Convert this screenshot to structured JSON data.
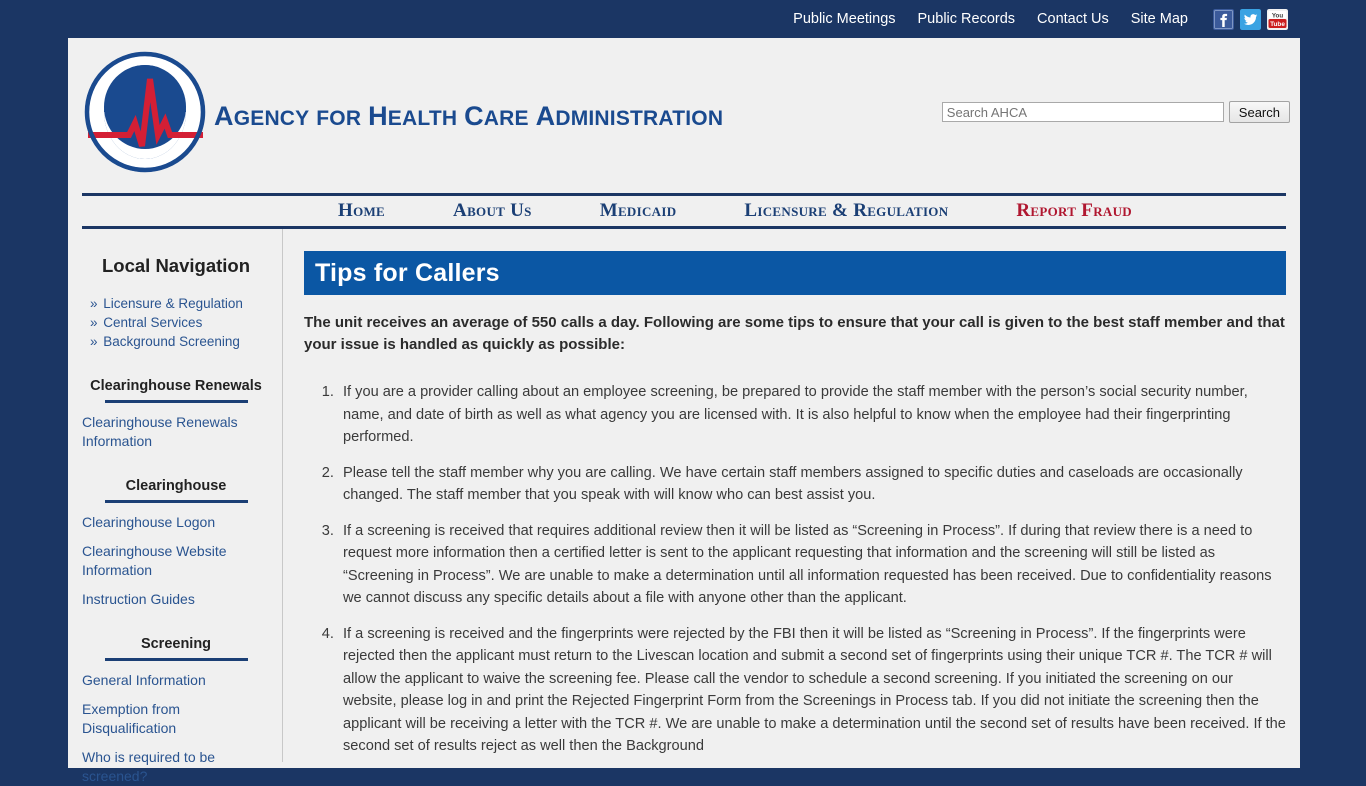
{
  "topbar": {
    "links": [
      {
        "label": "Public Meetings",
        "name": "public-meetings"
      },
      {
        "label": "Public Records",
        "name": "public-records"
      },
      {
        "label": "Contact Us",
        "name": "contact-us"
      },
      {
        "label": "Site Map",
        "name": "site-map"
      }
    ],
    "social": [
      {
        "icon": "facebook-icon",
        "label": "f",
        "color": "#3b5a9a"
      },
      {
        "icon": "twitter-icon",
        "label": "",
        "color": "#3aa3e3"
      },
      {
        "icon": "youtube-icon",
        "label": "You Tube",
        "color": "#cc1f1f"
      }
    ]
  },
  "header": {
    "logo_alt": "ahca-seal-logo",
    "brand": {
      "a1": "A",
      "w1": "GENCY",
      "sp1": " ",
      "f": "FOR",
      "sp2": " ",
      "h": "H",
      "w2": "EALTH",
      "sp3": " ",
      "c": "C",
      "w3": "ARE",
      "sp4": " ",
      "a2": "A",
      "w4": "DMINISTRATION"
    },
    "brand_full": "Agency for Health Care Administration",
    "search": {
      "placeholder": "Search AHCA",
      "value": "",
      "button_label": "Search"
    }
  },
  "mainnav": {
    "items": [
      {
        "label": "Home",
        "name": "nav-home",
        "alert": false
      },
      {
        "label": "About Us",
        "name": "nav-about-us",
        "alert": false
      },
      {
        "label": "Medicaid",
        "name": "nav-medicaid",
        "alert": false
      },
      {
        "label": "Licensure & Regulation",
        "name": "nav-licensure-regulation",
        "alert": false
      },
      {
        "label": "Report Fraud",
        "name": "nav-report-fraud",
        "alert": true
      }
    ]
  },
  "sidebar": {
    "title": "Local Navigation",
    "breadcrumbs": [
      {
        "label": "Licensure & Regulation",
        "name": "sidebar-crumb-licensure-regulation"
      },
      {
        "label": "Central Services",
        "name": "sidebar-crumb-central-services"
      },
      {
        "label": "Background Screening",
        "name": "sidebar-crumb-background-screening"
      }
    ],
    "sections": [
      {
        "heading": "Clearinghouse Renewals",
        "name": "sidebar-section-clearinghouse-renewals",
        "links": [
          {
            "label": "Clearinghouse Renewals Information",
            "name": "sidebar-link-clearinghouse-renewals-information"
          }
        ]
      },
      {
        "heading": "Clearinghouse",
        "name": "sidebar-section-clearinghouse",
        "links": [
          {
            "label": "Clearinghouse Logon",
            "name": "sidebar-link-clearinghouse-logon"
          },
          {
            "label": "Clearinghouse Website Information",
            "name": "sidebar-link-clearinghouse-website-information"
          },
          {
            "label": "Instruction Guides",
            "name": "sidebar-link-instruction-guides"
          }
        ]
      },
      {
        "heading": "Screening",
        "name": "sidebar-section-screening",
        "links": [
          {
            "label": "General Information",
            "name": "sidebar-link-general-information"
          },
          {
            "label": "Exemption from Disqualification",
            "name": "sidebar-link-exemption-from-disqualification"
          },
          {
            "label": "Who is required to be screened?",
            "name": "sidebar-link-who-is-required-to-be-screened"
          }
        ]
      }
    ]
  },
  "content": {
    "page_title": "Tips for Callers",
    "intro": "The unit receives an average of 550 calls a day. Following are some tips to ensure that your call is given to the best staff member and that your issue is handled as quickly as possible:",
    "tips": [
      "If you are a provider calling about an employee screening, be prepared to provide the staff member with the person’s social security number, name, and date of birth as well as what agency you are licensed with. It is also helpful to know when the employee had their fingerprinting performed.",
      "Please tell the staff member why you are calling. We have certain staff members assigned to specific duties and caseloads are occasionally changed. The staff member that you speak with will know who can best assist you.",
      "If a screening is received that requires additional review then it will be listed as “Screening in Process”. If during that review there is a need to request more information then a certified letter is sent to the applicant requesting that information and the screening will still be listed as “Screening in Process”. We are unable to make a determination until all information requested has been received. Due to confidentiality reasons we cannot discuss any specific details about a file with anyone other than the applicant.",
      "If a screening is received and the fingerprints were rejected by the FBI then it will be listed as “Screening in Process”. If the fingerprints were rejected then the applicant must return to the Livescan location and submit a second set of fingerprints using their unique TCR #. The TCR # will allow the applicant to waive the screening fee. Please call the vendor to schedule a second screening. If you initiated the screening on our website, please log in and print the Rejected Fingerprint Form from the Screenings in Process tab. If you did not initiate the screening then the applicant will be receiving a letter with the TCR #. We are unable to make a determination until the second set of results have been received. If the second set of results reject as well then the Background"
    ]
  },
  "colors": {
    "outer_background": "#1b3664",
    "page_background": "#f0f0f0",
    "navy": "#1b3f75",
    "banner_blue": "#0b57a4",
    "link_blue": "#2a5490",
    "alert_red": "#b01730",
    "logo_blue": "#1a4a8f",
    "logo_red": "#d41f35"
  }
}
